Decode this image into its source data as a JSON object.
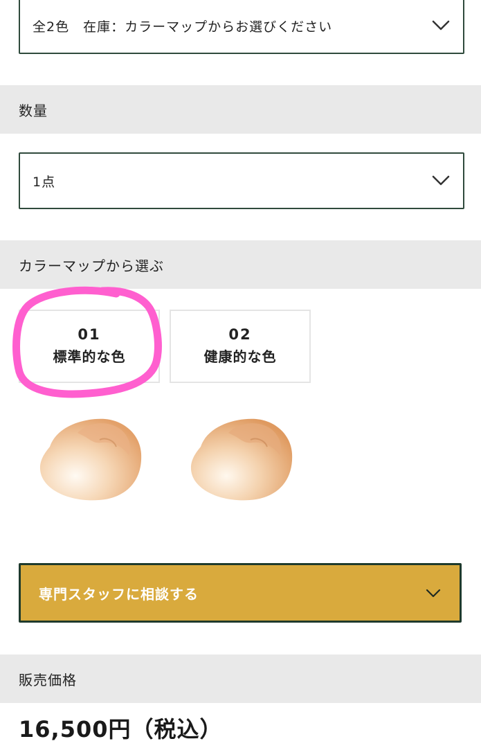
{
  "variant_select": {
    "value": "全2色　在庫：カラーマップからお選びください",
    "icon": "chevron-down-icon"
  },
  "quantity": {
    "heading": "数量",
    "select_value": "1点",
    "icon": "chevron-down-icon"
  },
  "color_map": {
    "heading": "カラーマップから選ぶ",
    "options": [
      {
        "number": "01",
        "name": "標準的な色",
        "selected_highlight": true
      },
      {
        "number": "02",
        "name": "健康的な色",
        "selected_highlight": false
      }
    ],
    "highlight_color": "#ff5fcf"
  },
  "consult_button": {
    "label": "専門スタッフに相談する",
    "icon": "chevron-down-icon",
    "background": "#d9aa3d"
  },
  "price_section": {
    "heading": "販売価格",
    "price": "16,500円（税込）"
  }
}
